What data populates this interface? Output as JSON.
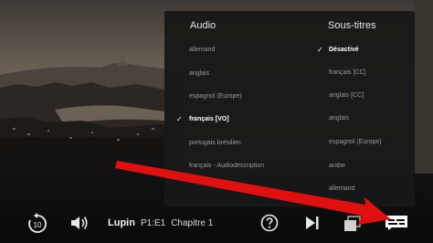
{
  "player": {
    "show_title": "Lupin",
    "episode_code": "P1:E1",
    "episode_name": "Chapitre 1"
  },
  "audio_subtitles": {
    "audio": {
      "header": "Audio",
      "options": [
        {
          "label": "allemand",
          "selected": false
        },
        {
          "label": "anglais",
          "selected": false
        },
        {
          "label": "espagnol (Europe)",
          "selected": false
        },
        {
          "label": "français [VO]",
          "selected": true
        },
        {
          "label": "portugais brésilien",
          "selected": false
        },
        {
          "label": "français - Audiodescription",
          "selected": false
        }
      ]
    },
    "subtitles": {
      "header": "Sous-titres",
      "options": [
        {
          "label": "Désactivé",
          "selected": true
        },
        {
          "label": "français [CC]",
          "selected": false
        },
        {
          "label": "anglais [CC]",
          "selected": false
        },
        {
          "label": "anglais",
          "selected": false
        },
        {
          "label": "espagnol (Europe)",
          "selected": false
        },
        {
          "label": "arabe",
          "selected": false
        },
        {
          "label": "allemand",
          "selected": false
        }
      ]
    },
    "check_glyph": "✓"
  },
  "controls": {
    "icons": [
      "skip-back-10-icon",
      "volume-icon",
      "help-icon",
      "next-episode-icon",
      "episodes-icon",
      "subtitles-icon"
    ],
    "replay_number": "10"
  },
  "colors": {
    "panel_bg": "#181818",
    "annotation_arrow": "#e01010"
  }
}
